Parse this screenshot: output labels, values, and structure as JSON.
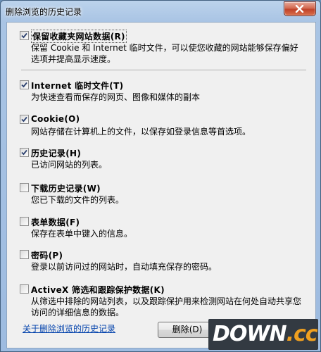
{
  "window": {
    "title": "删除浏览的历史记录"
  },
  "options": [
    {
      "label": "保留收藏夹网站数据(R)",
      "desc": "保留 Cookie 和 Internet 临时文件，可以使您收藏的网站能够保存偏好选项并提高显示速度。",
      "checked": true
    },
    {
      "label": "Internet 临时文件(T)",
      "desc": "为快速查看而保存的网页、图像和媒体的副本",
      "checked": true
    },
    {
      "label": "Cookie(O)",
      "desc": "网站存储在计算机上的文件，以保存如登录信息等首选项。",
      "checked": true
    },
    {
      "label": "历史记录(H)",
      "desc": "已访问网站的列表。",
      "checked": true
    },
    {
      "label": "下载历史记录(W)",
      "desc": "您已下载的文件的列表。",
      "checked": false
    },
    {
      "label": "表单数据(F)",
      "desc": "保存在表单中键入的信息。",
      "checked": false
    },
    {
      "label": "密码(P)",
      "desc": "登录以前访问过的网站时，自动填充保存的密码。",
      "checked": false
    },
    {
      "label": "ActiveX 筛选和跟踪保护数据(K)",
      "desc": "从筛选中排除的网站列表，以及跟踪保护用来检测网站在何处自动共享您访问的详细信息的数据。",
      "checked": false
    }
  ],
  "footer": {
    "help_link": "关于删除浏览的历史记录",
    "delete_label": "删除(D)"
  },
  "watermark": {
    "text": "DOWN",
    "suffix": ".cc"
  },
  "icons": {
    "close": "close-icon",
    "check": "checkmark-icon"
  }
}
